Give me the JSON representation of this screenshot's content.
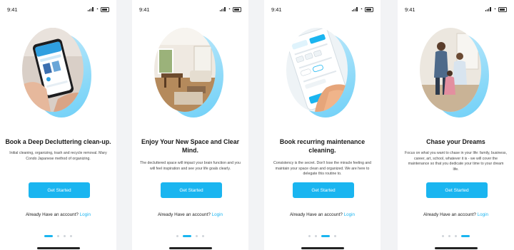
{
  "status": {
    "time": "9:41"
  },
  "screens": [
    {
      "title": "Book a Deep Decluttering clean-up.",
      "description": "Initial cleaning, organizing, trash and recycle removal. Mary Condo Japanese method of organizing.",
      "button": "Get Started",
      "account_text": "Already Have an account?",
      "login": "Login",
      "active_dot": 1
    },
    {
      "title": "Enjoy Your New Space and Clear Mind.",
      "description": "The decluttered space will impact your brain function and you will feel inspiration and see your life goals clearly.",
      "button": "Get Started",
      "account_text": "Already Have an account?",
      "login": "Login",
      "active_dot": 2
    },
    {
      "title": "Book recurring maintenance cleaning.",
      "description": "Consistency is the secret. Don't lose the miracle feeling and maintain your space clean and organized. We are here to delegate this routine to.",
      "button": "Get Started",
      "account_text": "Already Have an account?",
      "login": "Login",
      "active_dot": 3
    },
    {
      "title": "Chase your Dreams",
      "description": "Focus on what you want to chase in your life: family, business, career, art, school, whatever it is - we will cover the maintenance so that you dedicate your time to your dream life.",
      "button": "Get Started",
      "account_text": "Already Have an account?",
      "login": "Login",
      "active_dot": 4
    }
  ],
  "colors": {
    "accent": "#1ab5f0",
    "blob": "#6fd0f7"
  }
}
